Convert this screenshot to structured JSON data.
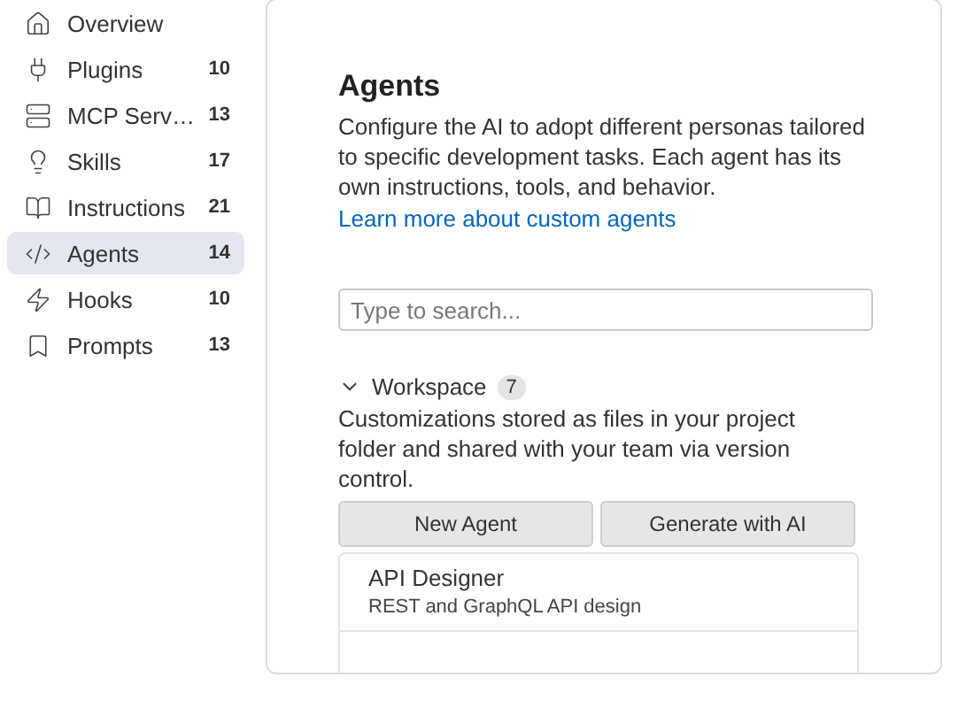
{
  "sidebar": {
    "items": [
      {
        "kind": "overview",
        "label": "Overview",
        "selected": false
      },
      {
        "kind": "plugins",
        "label": "Plugins",
        "count": "10",
        "selected": false
      },
      {
        "kind": "mcp",
        "label": "MCP Serv…",
        "count": "13",
        "selected": false
      },
      {
        "kind": "skills",
        "label": "Skills",
        "count": "17",
        "selected": false
      },
      {
        "kind": "instructions",
        "label": "Instructions",
        "count": "21",
        "selected": false
      },
      {
        "kind": "agents",
        "label": "Agents",
        "count": "14",
        "selected": true
      },
      {
        "kind": "hooks",
        "label": "Hooks",
        "count": "10",
        "selected": false
      },
      {
        "kind": "prompts",
        "label": "Prompts",
        "count": "13",
        "selected": false
      }
    ]
  },
  "main": {
    "title": "Agents",
    "description": "Configure the AI to adopt different personas tailored to specific development tasks. Each agent has its own instructions, tools, and behavior.",
    "link": "Learn more about custom agents",
    "search": {
      "placeholder": "Type to search..."
    },
    "section": {
      "title": "Workspace",
      "count": "7",
      "expanded": true,
      "description": "Customizations stored as files in your project folder and shared with your team via version control.",
      "buttons": [
        "New Agent",
        "Generate with AI"
      ],
      "items": [
        {
          "name": "API Designer",
          "description": "REST and GraphQL API design"
        }
      ]
    }
  }
}
